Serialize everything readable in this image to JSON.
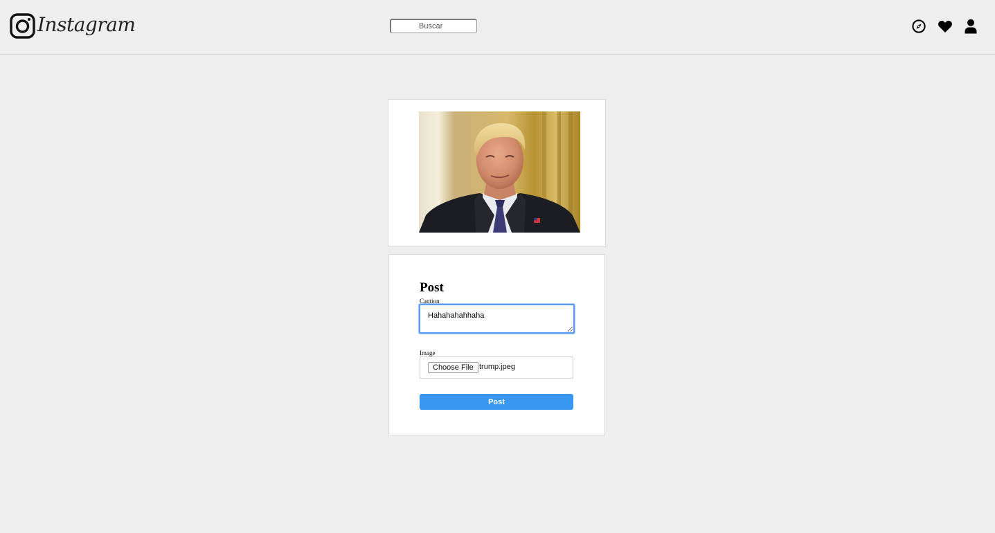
{
  "app": {
    "brand": "Instagram"
  },
  "header": {
    "search_placeholder": "Buscar",
    "icons": [
      "compass-icon",
      "heart-icon",
      "user-icon"
    ]
  },
  "preview": {
    "image_alt": "trump.jpeg preview"
  },
  "form": {
    "title": "Post",
    "caption_label": "Caption",
    "caption_value": "Hahahahahhaha",
    "image_label": "Image",
    "file_button_label": "Choose File",
    "file_name": "trump.jpeg",
    "submit_label": "Post"
  },
  "colors": {
    "accent": "#3897f0",
    "focus_ring": "#5b9bf1",
    "background": "#eeeeee",
    "card": "#ffffff"
  }
}
